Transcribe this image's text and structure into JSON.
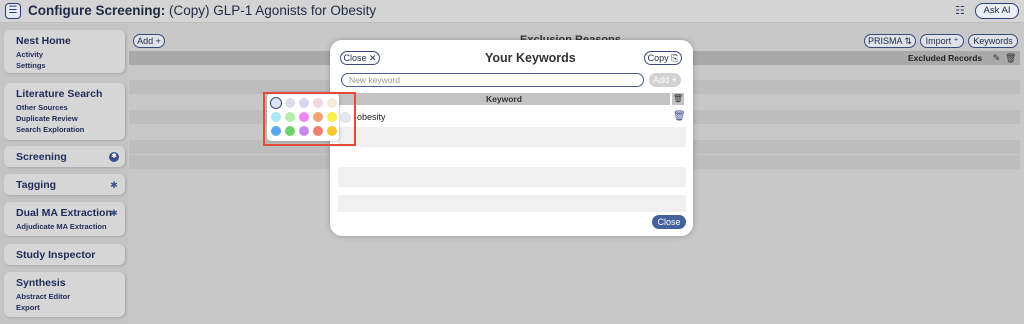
{
  "header": {
    "menu_icon": "hamburger-icon",
    "title_bold": "Configure Screening:",
    "title_rest": " (Copy) GLP-1 Agonists for Obesity",
    "db_icon": "database-icon",
    "ask_ai_label": "Ask AI"
  },
  "sidebar": {
    "nest_home": {
      "title": "Nest Home",
      "items": [
        "Activity",
        "Settings"
      ]
    },
    "literature_search": {
      "title": "Literature Search",
      "items": [
        "Other Sources",
        "Duplicate Review",
        "Search Exploration"
      ]
    },
    "screening": {
      "title": "Screening"
    },
    "tagging": {
      "title": "Tagging"
    },
    "dual_ma": {
      "title": "Dual MA Extraction",
      "items": [
        "Adjudicate MA Extraction"
      ]
    },
    "study_inspector": {
      "title": "Study Inspector"
    },
    "synthesis": {
      "title": "Synthesis",
      "items": [
        "Abstract Editor",
        "Export"
      ]
    }
  },
  "main": {
    "add_label": "Add +",
    "section_title": "Exclusion Reasons",
    "prisma_label": "PRISMA ⇅",
    "import_label": "Import ⁺",
    "keywords_label": "Keywords",
    "excluded_records_label": "Excluded Records"
  },
  "modal": {
    "close_label": "Close ✕",
    "title": "Your Keywords",
    "copy_label": "Copy ⎘",
    "input_placeholder": "New keyword",
    "add_label": "Add +",
    "column_header": "Keyword",
    "keywords": [
      {
        "text": "obesity"
      }
    ],
    "close_bottom_label": "Close"
  },
  "color_picker": {
    "rows": [
      [
        "#dde3f0",
        "#dadde6",
        "#d9d2ee",
        "#f3d6df",
        "#f6ead9"
      ],
      [
        "#a9e6f4",
        "#b4ecac",
        "#ee86ee",
        "#f1a46e",
        "#f6f04b"
      ],
      [
        "#5aa6ee",
        "#6cd46c",
        "#c98aee",
        "#ef7f6e",
        "#f6c92e"
      ]
    ],
    "selected": [
      0,
      0
    ]
  },
  "colors": {
    "accent": "#2c3e78",
    "highlight": "#e04b3a",
    "primary_button": "#44619e"
  }
}
